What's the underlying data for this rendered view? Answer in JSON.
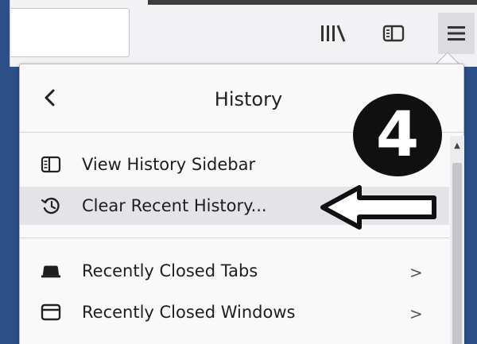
{
  "toolbar": {
    "url_value": "",
    "library_icon": "library-icon",
    "sidebar_icon": "sidebar-icon",
    "menu_icon": "hamburger-menu-icon"
  },
  "panel": {
    "title": "History",
    "back_icon": "chevron-left-icon",
    "items": [
      {
        "label": "View History Sidebar",
        "icon": "sidebar-icon",
        "has_submenu": false
      },
      {
        "label": "Clear Recent History...",
        "icon": "history-clear-icon",
        "has_submenu": false,
        "highlighted": true
      },
      {
        "label": "Recently Closed Tabs",
        "icon": "tab-icon",
        "has_submenu": true,
        "chevron": ">"
      },
      {
        "label": "Recently Closed Windows",
        "icon": "window-icon",
        "has_submenu": true,
        "chevron": ">"
      }
    ]
  },
  "annotation": {
    "step_number": "4",
    "pointer": "left-arrow"
  },
  "colors": {
    "desktop": "#2b4f86",
    "toolbar": "#f2f2f4",
    "panel": "#f9f9fa",
    "highlight": "#e4e4e8",
    "badge": "#101010"
  }
}
